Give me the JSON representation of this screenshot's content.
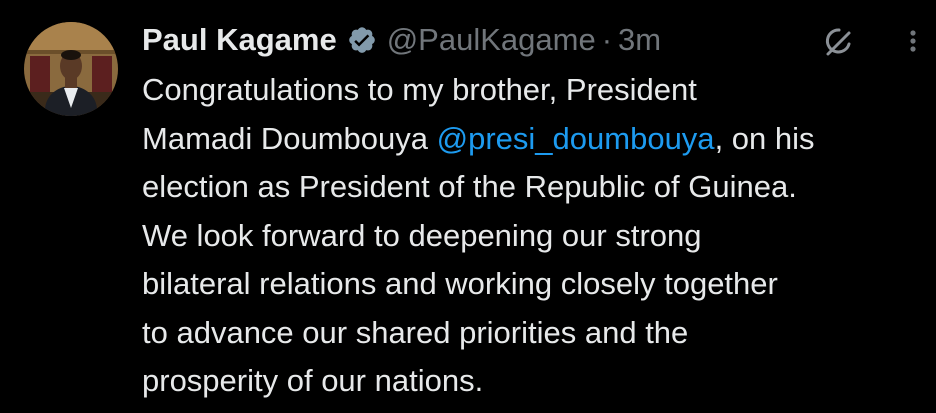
{
  "colors": {
    "background": "#000000",
    "text_primary": "#e7e9ea",
    "text_secondary": "#71767b",
    "link": "#1d9bf0",
    "verified_badge": "#829aab"
  },
  "tweet": {
    "author": {
      "display_name": "Paul Kagame",
      "verified_icon": "verified-badge-icon",
      "handle": "@PaulKagame"
    },
    "separator": "·",
    "timestamp": "3m",
    "header_icons": [
      "grok-icon",
      "more-options-icon"
    ],
    "text": {
      "line1": "Congratulations to my brother, President",
      "line2_before": "Mamadi Doumbouya ",
      "mention": "@presi_doumbouya",
      "line2_after": ", on his",
      "line3": "election as President of the Republic of Guinea.",
      "line4": "We look forward to deepening our strong",
      "line5": "bilateral relations and working closely together",
      "line6": "to advance our shared priorities and the",
      "line7": "prosperity of our nations."
    }
  }
}
